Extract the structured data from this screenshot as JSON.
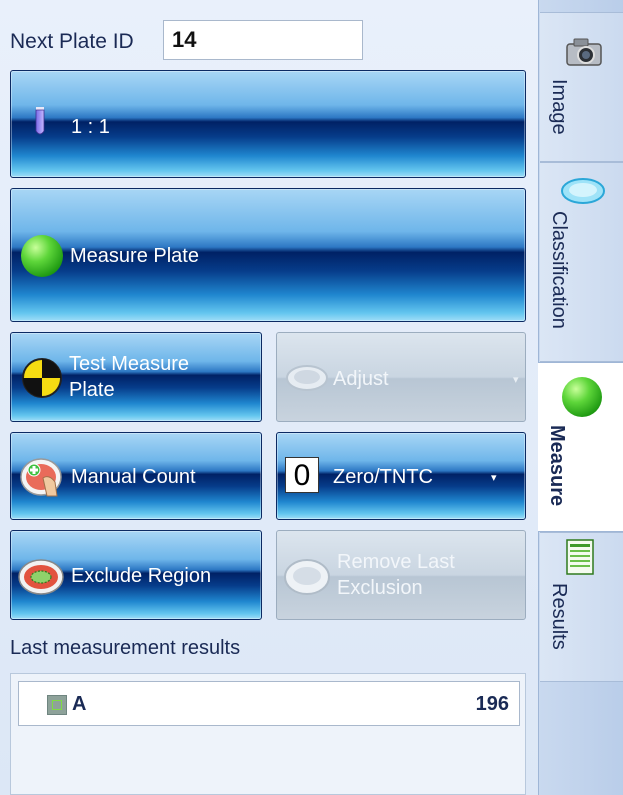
{
  "plate": {
    "id_label": "Next Plate ID",
    "id_value": "14"
  },
  "dilution": {
    "label": "1 : 1"
  },
  "buttons": {
    "measure_plate": "Measure Plate",
    "test_measure_line1": "Test Measure",
    "test_measure_line2": "Plate",
    "adjust": "Adjust",
    "manual_count": "Manual Count",
    "zero_tntc_digit": "0",
    "zero_tntc": "Zero/TNTC",
    "exclude_region": "Exclude Region",
    "remove_last_line1": "Remove Last",
    "remove_last_line2": "Exclusion"
  },
  "results": {
    "title": "Last measurement results",
    "rows": [
      {
        "label": "A",
        "value": "196",
        "swatch_color": "#8ea29a"
      }
    ]
  },
  "tabs": [
    {
      "label": "Image",
      "icon": "camera-icon",
      "active": false
    },
    {
      "label": "Classification",
      "icon": "petri-dish-icon",
      "active": false
    },
    {
      "label": "Measure",
      "icon": "green-ball-icon",
      "active": true
    },
    {
      "label": "Results",
      "icon": "spreadsheet-icon",
      "active": false
    }
  ],
  "colors": {
    "button_dark_blue": "#002165",
    "button_light_blue": "#64c6ef",
    "indicator_green": "#5ed63a"
  }
}
